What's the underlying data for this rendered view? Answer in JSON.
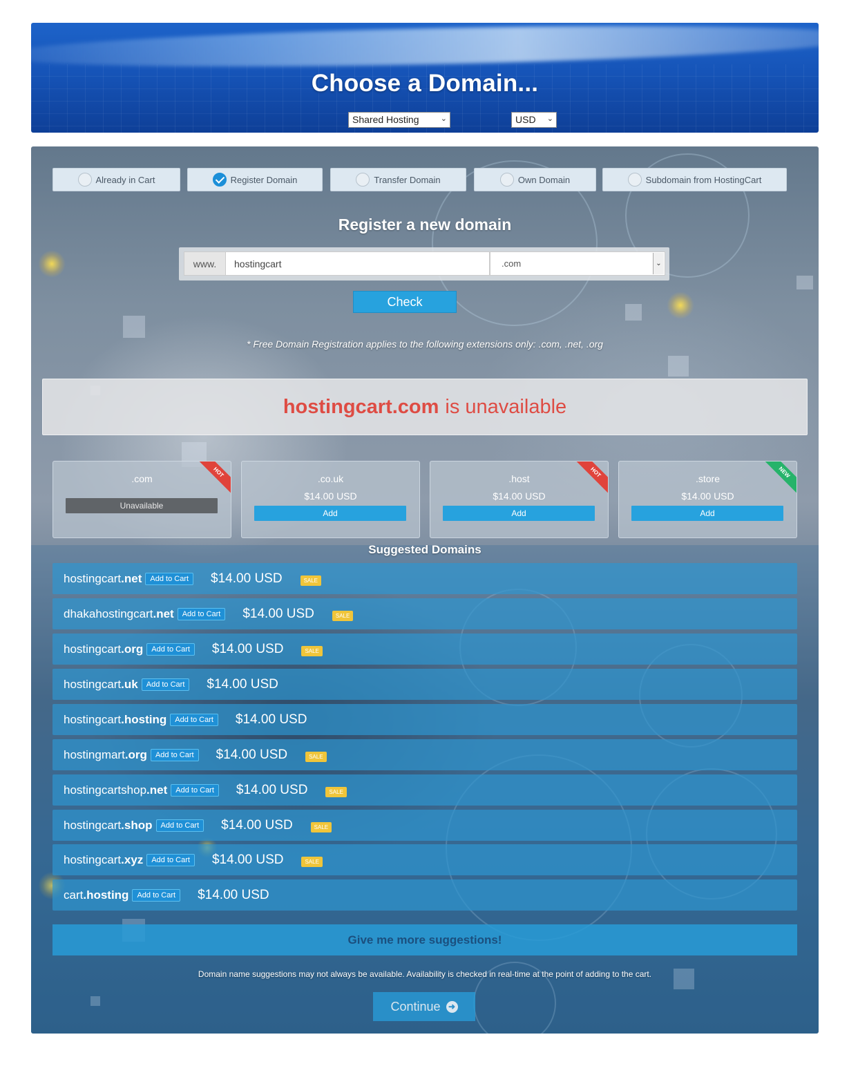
{
  "header": {
    "title": "Choose a Domain...",
    "product_select": "Shared Hosting",
    "currency_select": "USD"
  },
  "options": [
    {
      "label": "Already in Cart",
      "checked": false
    },
    {
      "label": "Register Domain",
      "checked": true
    },
    {
      "label": "Transfer Domain",
      "checked": false
    },
    {
      "label": "Own Domain",
      "checked": false
    },
    {
      "label": "Subdomain from HostingCart",
      "checked": false
    }
  ],
  "register": {
    "title": "Register a new domain",
    "prefix": "www.",
    "domain_value": "hostingcart",
    "tld_select": ".com",
    "check_label": "Check",
    "free_note": "* Free Domain Registration applies to the following extensions only: .com, .net, .org"
  },
  "result": {
    "domain": "hostingcart.com",
    "status": "is unavailable"
  },
  "tld_cards": [
    {
      "tld": ".com",
      "price": "",
      "button": "Unavailable",
      "ribbon": "HOT"
    },
    {
      "tld": ".co.uk",
      "price": "$14.00 USD",
      "button": "Add",
      "ribbon": ""
    },
    {
      "tld": ".host",
      "price": "$14.00 USD",
      "button": "Add",
      "ribbon": "HOT"
    },
    {
      "tld": ".store",
      "price": "$14.00 USD",
      "button": "Add",
      "ribbon": "NEW"
    }
  ],
  "suggestions": {
    "title": "Suggested Domains",
    "add_label": "Add to Cart",
    "sale_label": "SALE",
    "items": [
      {
        "sld": "hostingcart",
        "tld": ".net",
        "price": "$14.00 USD",
        "sale": true
      },
      {
        "sld": "dhakahostingcart",
        "tld": ".net",
        "price": "$14.00 USD",
        "sale": true
      },
      {
        "sld": "hostingcart",
        "tld": ".org",
        "price": "$14.00 USD",
        "sale": true
      },
      {
        "sld": "hostingcart",
        "tld": ".uk",
        "price": "$14.00 USD",
        "sale": false
      },
      {
        "sld": "hostingcart",
        "tld": ".hosting",
        "price": "$14.00 USD",
        "sale": false
      },
      {
        "sld": "hostingmart",
        "tld": ".org",
        "price": "$14.00 USD",
        "sale": true
      },
      {
        "sld": "hostingcartshop",
        "tld": ".net",
        "price": "$14.00 USD",
        "sale": true
      },
      {
        "sld": "hostingcart",
        "tld": ".shop",
        "price": "$14.00 USD",
        "sale": true
      },
      {
        "sld": "hostingcart",
        "tld": ".xyz",
        "price": "$14.00 USD",
        "sale": true
      },
      {
        "sld": "cart",
        "tld": ".hosting",
        "price": "$14.00 USD",
        "sale": false
      }
    ],
    "more_label": "Give me more suggestions!",
    "disclaimer": "Domain name suggestions may not always be available. Availability is checked in real-time at the point of adding to the cart."
  },
  "continue_label": "Continue",
  "icons": {
    "radio_checked": "checkmark-icon",
    "continue": "arrow-right-circle-icon"
  },
  "colors": {
    "accent": "#27a2de",
    "unavailable": "#de4c44",
    "hot": "#e0433b",
    "new": "#26b36a",
    "sale": "#f0c53a"
  }
}
